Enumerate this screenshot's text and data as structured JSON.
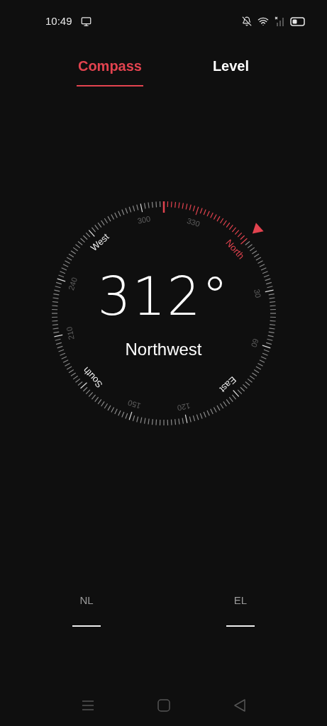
{
  "status_bar": {
    "time": "10:49"
  },
  "tabs": [
    {
      "label": "Compass",
      "selected": true
    },
    {
      "label": "Level",
      "selected": false
    }
  ],
  "compass": {
    "heading": "312°",
    "direction": "Northwest",
    "cardinal_labels": [
      {
        "text": "North",
        "highlighted": true
      },
      {
        "text": "East",
        "highlighted": false
      },
      {
        "text": "South",
        "highlighted": false
      },
      {
        "text": "West",
        "highlighted": false
      }
    ],
    "degree_labels": [
      "30",
      "60",
      "120",
      "150",
      "210",
      "240",
      "300",
      "330"
    ]
  },
  "readouts": [
    {
      "label": "NL",
      "value": "——"
    },
    {
      "label": "EL",
      "value": "——"
    }
  ]
}
